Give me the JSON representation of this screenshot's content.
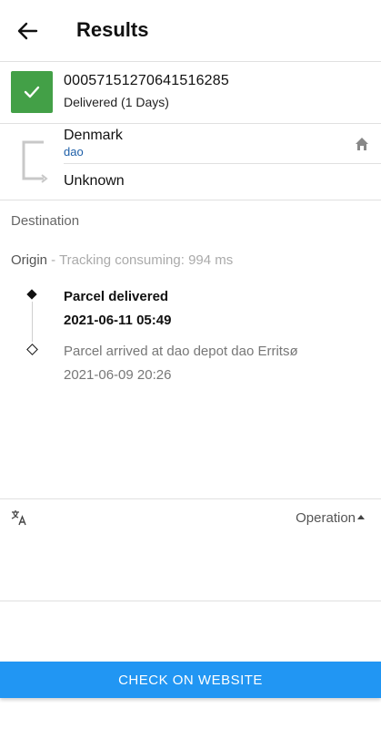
{
  "header": {
    "title": "Results",
    "back_icon": "arrow-left-icon"
  },
  "shipment": {
    "tracking_number": "00057151270641516285",
    "status_text": "Delivered (1 Days)",
    "status_color": "#43a047",
    "status_icon": "check-icon"
  },
  "route": {
    "origin_country": "Denmark",
    "carrier": "dao",
    "destination_country": "Unknown",
    "home_icon": "home-icon"
  },
  "sections": {
    "destination_label": "Destination",
    "origin_label": "Origin",
    "consuming_text": " - Tracking consuming: 994 ms"
  },
  "events": [
    {
      "title": "Parcel delivered",
      "time": "2021-06-11 05:49"
    },
    {
      "title": "Parcel arrived at dao depot dao Erritsø",
      "time": "2021-06-09 20:26"
    }
  ],
  "footer": {
    "operation_label": "Operation",
    "translate_icon": "translate-icon",
    "check_button_label": "CHECK ON WEBSITE",
    "accent_color": "#2196f3"
  }
}
